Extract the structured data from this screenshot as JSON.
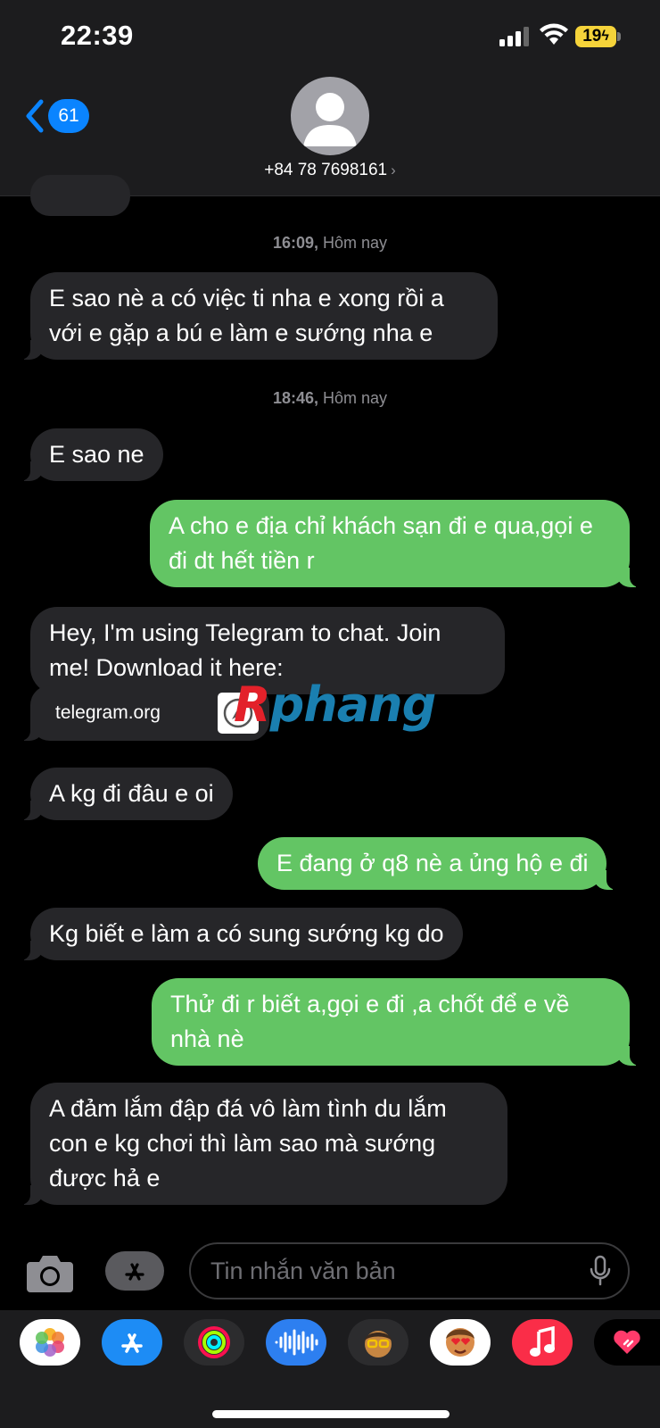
{
  "status_bar": {
    "time": "22:39",
    "battery": "19"
  },
  "nav": {
    "back_count": "61",
    "contact": "+84 78 7698161",
    "contact_chevron": "›"
  },
  "conversation": {
    "timestamps": [
      {
        "time": "16:09,",
        "day": " Hôm nay"
      },
      {
        "time": "18:46,",
        "day": " Hôm nay"
      }
    ],
    "messages": [
      {
        "dir": "in",
        "text": "E sao nè a có việc ti nha e xong rồi a với e gặp a bú e làm e sướng nha e"
      },
      {
        "dir": "in",
        "text": "E sao ne"
      },
      {
        "dir": "out",
        "text": "A cho e địa chỉ khách sạn đi e qua,gọi e đi dt hết tiền r"
      },
      {
        "dir": "in",
        "text": "Hey, I'm using Telegram to chat. Join me! Download it here:"
      },
      {
        "dir": "in",
        "text": "A kg đi đâu e oi"
      },
      {
        "dir": "out",
        "text": "E đang ở q8 nè a ủng hộ e đi"
      },
      {
        "dir": "in",
        "text": "Kg biết e làm a có sung sướng kg do"
      },
      {
        "dir": "out",
        "text": "Thử đi r biết a,gọi e đi ,a chốt để e về nhà nè"
      },
      {
        "dir": "in",
        "text": "A đảm lắm đập đá vô làm tình du lắm con e kg chơi thì làm sao mà sướng được hả e"
      }
    ],
    "link_preview": {
      "domain": "telegram.org",
      "icon": "safari-compass-icon"
    }
  },
  "watermark": {
    "first": "R",
    "rest": "phang"
  },
  "composer": {
    "placeholder": "Tin nhắn văn bản",
    "icons": [
      "camera-icon",
      "app-store-icon",
      "microphone-icon"
    ]
  },
  "app_drawer": {
    "apps": [
      "photos-icon",
      "app-store-icon",
      "activity-icon",
      "audio-message-icon",
      "memoji-icon",
      "animoji-icon",
      "music-icon",
      "digital-touch-icon"
    ]
  },
  "colors": {
    "incoming": "#262629",
    "outgoing": "#63c564",
    "accent": "#0a84ff",
    "battery": "#f5d33a"
  }
}
